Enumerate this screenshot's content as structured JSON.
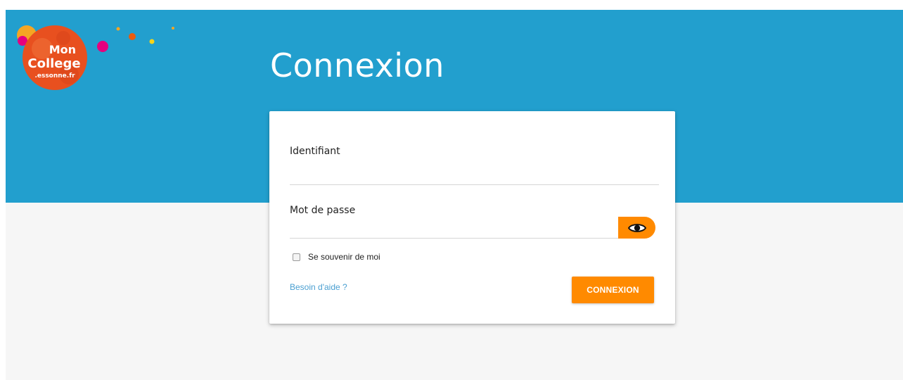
{
  "logo": {
    "line1": "Mon",
    "line2": "College",
    "line3": ".essonne.fr"
  },
  "header": {
    "title": "Connexion"
  },
  "form": {
    "identifier_label": "Identifiant",
    "identifier_value": "",
    "password_label": "Mot de passe",
    "password_value": "",
    "show_password_icon": "eye-icon",
    "remember_label": "Se souvenir de moi",
    "remember_checked": false,
    "help_link": "Besoin d'aide ?",
    "submit_label": "CONNEXION"
  },
  "colors": {
    "header_band": "#229fce",
    "accent": "#ff8a00",
    "link": "#4a9fd1",
    "page_background": "#f6f6f6"
  }
}
